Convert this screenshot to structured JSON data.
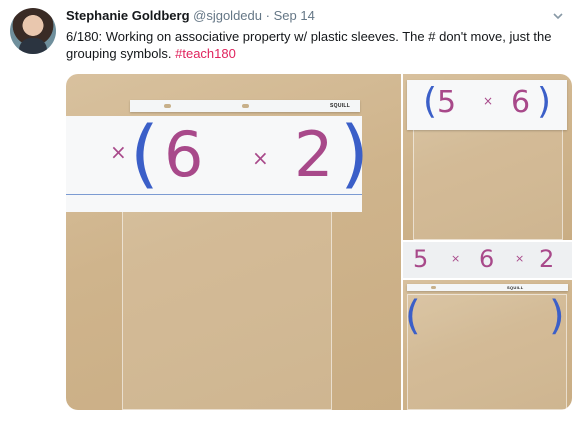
{
  "tweet": {
    "author_name": "Stephanie Goldberg",
    "handle": "@sjgoldedu",
    "separator": "·",
    "date": "Sep 14",
    "text_main": "6/180: Working on associative property w/ plastic sleeves. The # don't move, just the grouping symbols. ",
    "hashtag": "#teach180"
  },
  "media": {
    "main": {
      "left_times": "×",
      "paren_open": "(",
      "num_a": "6",
      "times": "×",
      "num_b": "2",
      "paren_close": ")",
      "brand": "SQUILL"
    },
    "top": {
      "paren_open": "(",
      "num_a": "5",
      "times": "×",
      "num_b": "6",
      "paren_close": ")"
    },
    "middle": {
      "num_a": "5",
      "times_a": "×",
      "num_b": "6",
      "times_b": "×",
      "num_c": "2"
    },
    "bottom": {
      "paren_open": "(",
      "paren_close": ")",
      "brand": "SQUILL"
    }
  },
  "icons": {
    "caret": "chevron-down-icon"
  }
}
